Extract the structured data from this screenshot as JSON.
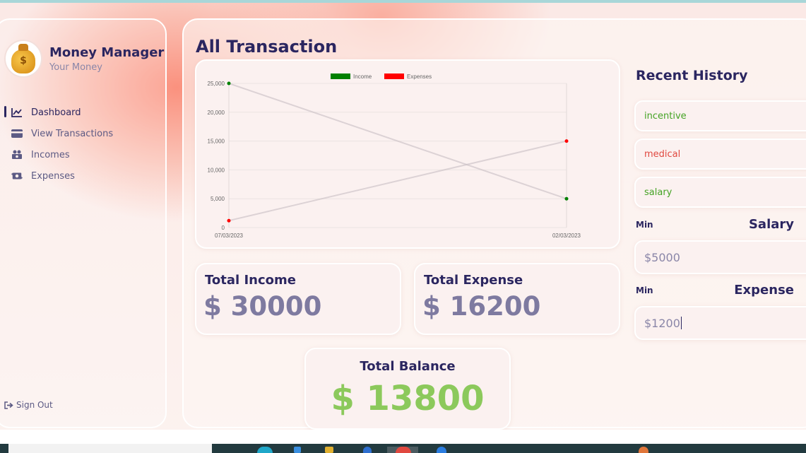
{
  "app": {
    "name": "Money Manager",
    "subtitle": "Your Money",
    "avatar_icon": "money-bag-icon"
  },
  "sidebar": {
    "items": [
      {
        "label": "Dashboard",
        "icon": "line-chart-icon",
        "active": true
      },
      {
        "label": "View Transactions",
        "icon": "credit-card-icon",
        "active": false
      },
      {
        "label": "Incomes",
        "icon": "money-stack-icon",
        "active": false
      },
      {
        "label": "Expenses",
        "icon": "money-exchange-icon",
        "active": false
      }
    ],
    "signout_label": "Sign Out",
    "signout_icon": "sign-out-icon"
  },
  "main": {
    "title": "All Transaction",
    "total_income": {
      "title": "Total Income",
      "value": "$ 30000"
    },
    "total_expense": {
      "title": "Total Expense",
      "value": "$ 16200"
    },
    "total_balance": {
      "title": "Total Balance",
      "value": "$ 13800"
    }
  },
  "history": {
    "title": "Recent History",
    "items": [
      {
        "label": "incentive",
        "kind": "income"
      },
      {
        "label": "medical",
        "kind": "expense"
      },
      {
        "label": "salary",
        "kind": "income"
      }
    ]
  },
  "minmax": {
    "salary": {
      "min_label": "Min",
      "label": "Salary",
      "value": "$5000"
    },
    "expense": {
      "min_label": "Min",
      "label": "Expense",
      "value": "$1200"
    }
  },
  "colors": {
    "income": "#008000",
    "expense": "#ff0000",
    "balance": "#8cc95c",
    "heading": "#2b2660"
  },
  "chart_data": {
    "type": "line",
    "categories": [
      "07/03/2023",
      "02/03/2023"
    ],
    "series": [
      {
        "name": "Income",
        "values": [
          25000,
          5000
        ],
        "color": "#008000"
      },
      {
        "name": "Expenses",
        "values": [
          1200,
          15000
        ],
        "color": "#ff0000"
      }
    ],
    "yticks": [
      "0",
      "5,000",
      "10,000",
      "15,000",
      "20,000",
      "25,000"
    ],
    "ylim": [
      0,
      25000
    ],
    "grid": true,
    "legend_position": "top"
  }
}
